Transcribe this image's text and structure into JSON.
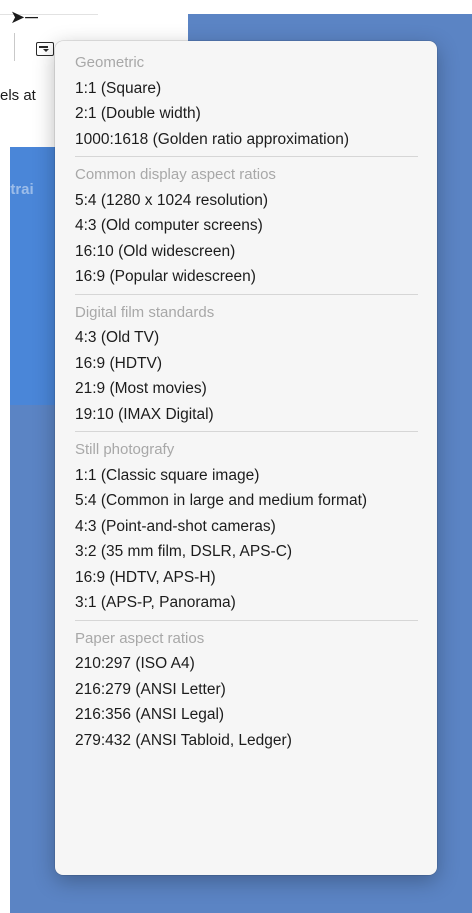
{
  "background": {
    "partial_label_left": "els at",
    "partial_label_constrain": "strai"
  },
  "menu": {
    "sections": [
      {
        "header": "Geometric",
        "items": [
          "1:1 (Square)",
          "2:1 (Double width)",
          "1000:1618 (Golden ratio approximation)"
        ]
      },
      {
        "header": "Common display aspect ratios",
        "items": [
          "5:4 (1280 x 1024 resolution)",
          "4:3 (Old computer screens)",
          "16:10 (Old widescreen)",
          "16:9 (Popular widescreen)"
        ]
      },
      {
        "header": "Digital film standards",
        "items": [
          "4:3 (Old TV)",
          "16:9 (HDTV)",
          "21:9 (Most movies)",
          "19:10 (IMAX Digital)"
        ]
      },
      {
        "header": "Still photografy",
        "items": [
          "1:1 (Classic square image)",
          "5:4 (Common in large and medium format)",
          "4:3 (Point-and-shot cameras)",
          "3:2 (35 mm film, DSLR, APS-C)",
          "16:9 (HDTV, APS-H)",
          "3:1 (APS-P, Panorama)"
        ]
      },
      {
        "header": "Paper aspect ratios",
        "items": [
          "210:297 (ISO A4)",
          "216:279 (ANSI Letter)",
          "216:356 (ANSI Legal)",
          "279:432 (ANSI Tabloid, Ledger)"
        ]
      }
    ]
  }
}
